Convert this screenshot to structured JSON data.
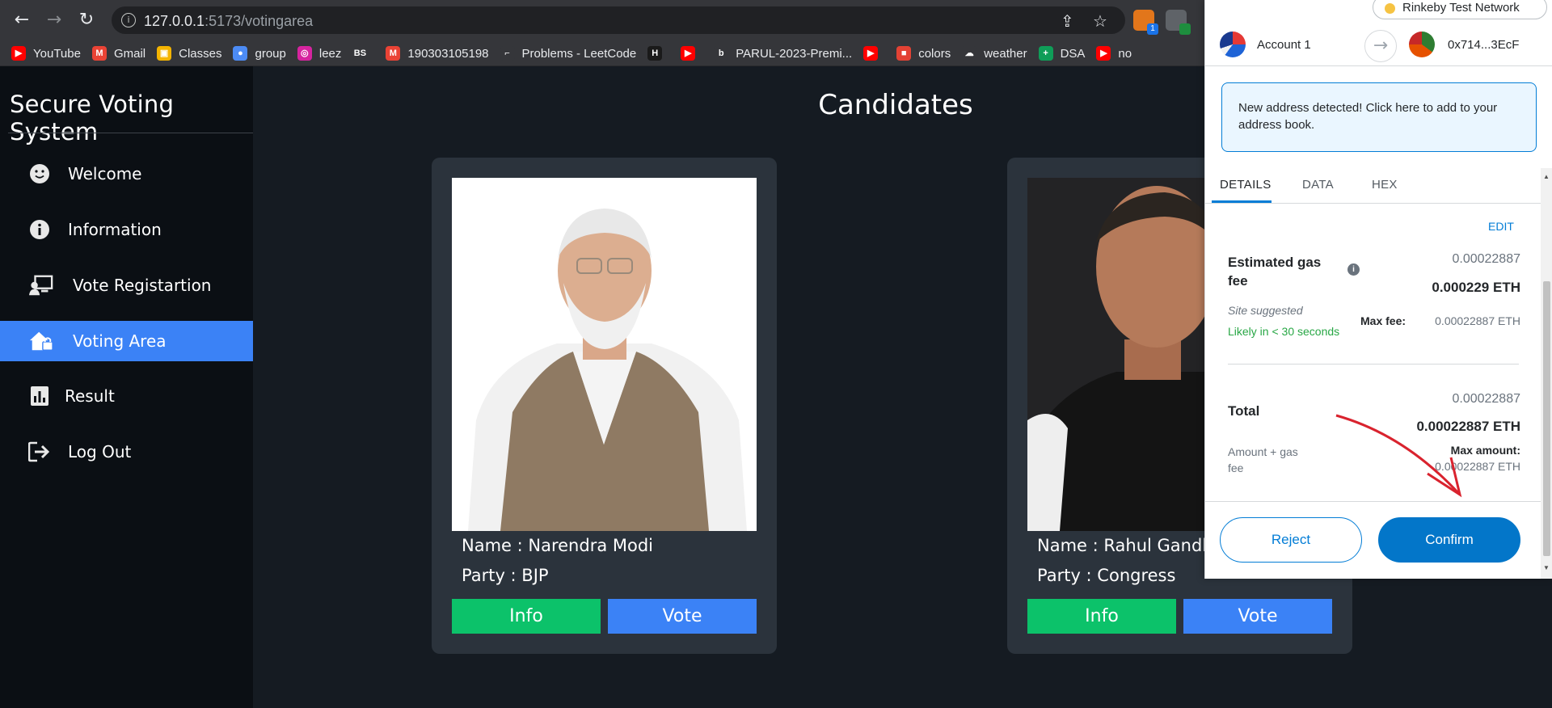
{
  "browser": {
    "url_host": "127.0.0.1",
    "url_path": ":5173/votingarea",
    "bookmarks": [
      {
        "label": "YouTube",
        "color": "#ff0000",
        "glyph": "▶"
      },
      {
        "label": "Gmail",
        "color": "#ea4335",
        "glyph": "M"
      },
      {
        "label": "Classes",
        "color": "#f4b400",
        "glyph": "▣"
      },
      {
        "label": "group",
        "color": "#4c8bf5",
        "glyph": "●"
      },
      {
        "label": "leez",
        "color": "#d6249f",
        "glyph": "◎"
      },
      {
        "label": "",
        "color": "#35363a",
        "glyph": "BS"
      },
      {
        "label": "190303105198",
        "color": "#ea4335",
        "glyph": "M"
      },
      {
        "label": "Problems - LeetCode",
        "color": "#35363a",
        "glyph": "⌐"
      },
      {
        "label": "",
        "color": "#1a1a1a",
        "glyph": "H"
      },
      {
        "label": "",
        "color": "#ff0000",
        "glyph": "▶"
      },
      {
        "label": "PARUL-2023-Premi...",
        "color": "#35363a",
        "glyph": "b"
      },
      {
        "label": "",
        "color": "#ff0000",
        "glyph": "▶"
      },
      {
        "label": "colors",
        "color": "#e34234",
        "glyph": "■"
      },
      {
        "label": "weather",
        "color": "#35363a",
        "glyph": "☁"
      },
      {
        "label": "DSA",
        "color": "#0f9d58",
        "glyph": "+"
      },
      {
        "label": "no",
        "color": "#ff0000",
        "glyph": "▶"
      }
    ],
    "extension_badge": "1"
  },
  "app": {
    "title": "Secure Voting System",
    "heading": "Candidates",
    "menu": [
      {
        "label": "Welcome",
        "icon": "smiley-icon",
        "active": false
      },
      {
        "label": "Information",
        "icon": "info-icon",
        "active": false
      },
      {
        "label": "Vote Registartion",
        "icon": "registration-icon",
        "active": false
      },
      {
        "label": "Voting Area",
        "icon": "home-lock-icon",
        "active": true
      },
      {
        "label": "Result",
        "icon": "bar-chart-icon",
        "active": false
      },
      {
        "label": "Log Out",
        "icon": "logout-icon",
        "active": false
      }
    ],
    "candidates": [
      {
        "name_line": "Name : Narendra Modi",
        "party_line": "Party : BJP",
        "info_label": "Info",
        "vote_label": "Vote"
      },
      {
        "name_line": "Name : Rahul Gandhi",
        "party_line": "Party : Congress",
        "info_label": "Info",
        "vote_label": "Vote"
      }
    ],
    "colors": {
      "active": "#3b82f6",
      "info_button": "#0cc26a",
      "vote_button": "#3b82f6"
    }
  },
  "wallet": {
    "network": "Rinkeby Test Network",
    "from_account": "Account 1",
    "to_address": "0x714...3EcF",
    "notice": "New address detected! Click here to add to your address book.",
    "tabs": [
      "DETAILS",
      "DATA",
      "HEX"
    ],
    "edit_label": "EDIT",
    "gas_label": "Estimated gas fee",
    "gas_value_gray": "0.00022887",
    "gas_value_bold": "0.000229 ETH",
    "site_suggested": "Site suggested",
    "likely": "Likely in < 30 seconds",
    "max_fee_label": "Max fee:",
    "max_fee_value": "0.00022887 ETH",
    "total_label": "Total",
    "total_value_gray": "0.00022887",
    "total_value_bold": "0.00022887 ETH",
    "amount_gas_label": "Amount + gas fee",
    "max_amount_label": "Max amount:",
    "max_amount_value": "0.00022887 ETH",
    "reject_label": "Reject",
    "confirm_label": "Confirm",
    "accent": "#037dd6"
  }
}
